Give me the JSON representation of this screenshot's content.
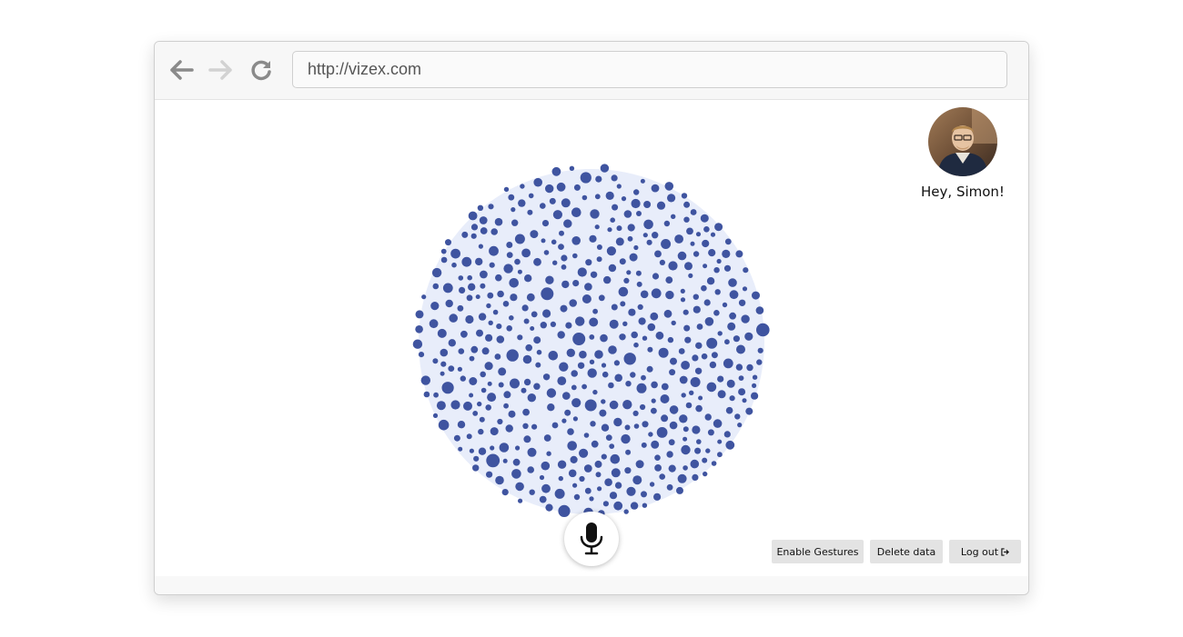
{
  "browser": {
    "url": "http://vizex.com",
    "back_icon": "arrow-left-icon",
    "forward_icon": "arrow-right-icon",
    "reload_icon": "reload-icon"
  },
  "user": {
    "greeting": "Hey, Simon!",
    "avatar_icon": "user-avatar"
  },
  "graph": {
    "node_color": "#3f54a0",
    "halo_color": "#e8edfa",
    "node_count": 520
  },
  "mic": {
    "icon": "microphone-icon"
  },
  "actions": {
    "enable_gestures": "Enable Gestures",
    "delete_data": "Delete data",
    "logout": "Log out",
    "logout_icon": "sign-out-icon"
  }
}
